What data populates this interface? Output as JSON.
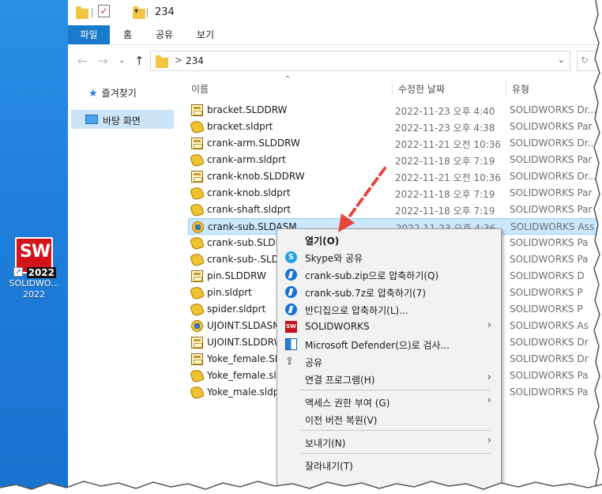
{
  "desktop": {
    "icon_label": "SOLIDWO... 2022",
    "logo_text": "SW",
    "logo_year": "2022"
  },
  "titlebar": {
    "title": "234"
  },
  "ribbon": {
    "tabs": [
      "파일",
      "홈",
      "공유",
      "보기"
    ]
  },
  "address": {
    "path": "234",
    "separator": ">"
  },
  "nav": {
    "favorites": "즐겨찾기",
    "desktop": "바탕 화면"
  },
  "columns": {
    "name": "이름",
    "date": "수정한 날짜",
    "type": "유형"
  },
  "files": [
    {
      "name": "bracket.SLDDRW",
      "date": "2022-11-23 오후 4:40",
      "type": "SOLIDWORKS Dr...",
      "kind": "drw"
    },
    {
      "name": "bracket.sldprt",
      "date": "2022-11-23 오후 4:38",
      "type": "SOLIDWORKS Par",
      "kind": "prt"
    },
    {
      "name": "crank-arm.SLDDRW",
      "date": "2022-11-21 오전 10:36",
      "type": "SOLIDWORKS Dr...",
      "kind": "drw"
    },
    {
      "name": "crank-arm.sldprt",
      "date": "2022-11-18 오후 7:19",
      "type": "SOLIDWORKS Par",
      "kind": "prt"
    },
    {
      "name": "crank-knob.SLDDRW",
      "date": "2022-11-21 오전 10:36",
      "type": "SOLIDWORKS Dr...",
      "kind": "drw"
    },
    {
      "name": "crank-knob.sldprt",
      "date": "2022-11-18 오후 7:19",
      "type": "SOLIDWORKS Par",
      "kind": "prt"
    },
    {
      "name": "crank-shaft.sldprt",
      "date": "2022-11-18 오후 7:19",
      "type": "SOLIDWORKS Par",
      "kind": "prt"
    },
    {
      "name": "crank-sub.SLDASM",
      "date": "2022-11-23 오후 4:36",
      "type": "SOLIDWORKS Ass",
      "kind": "asm",
      "selected": true
    },
    {
      "name": "crank-sub.SLDPI",
      "date": "",
      "type": "SOLIDWORKS Pa",
      "kind": "prt"
    },
    {
      "name": "crank-sub-.SLDI",
      "date": "",
      "type": "SOLIDWORKS Pa",
      "kind": "prt"
    },
    {
      "name": "pin.SLDDRW",
      "date": "",
      "type": "SOLIDWORKS D",
      "kind": "drw"
    },
    {
      "name": "pin.sldprt",
      "date": "",
      "type": "SOLIDWORKS P",
      "kind": "prt"
    },
    {
      "name": "spider.sldprt",
      "date": "",
      "type": "SOLIDWORKS P",
      "kind": "prt"
    },
    {
      "name": "UJOINT.SLDASM",
      "date": "",
      "type": "SOLIDWORKS As",
      "kind": "asm"
    },
    {
      "name": "UJOINT.SLDDRW",
      "date": "",
      "type": "SOLIDWORKS Dr",
      "kind": "drw"
    },
    {
      "name": "Yoke_female.SLD",
      "date": "",
      "type": "SOLIDWORKS Dr",
      "kind": "drw"
    },
    {
      "name": "Yoke_female.sldp",
      "date": "",
      "type": "SOLIDWORKS Pa",
      "kind": "prt"
    },
    {
      "name": "Yoke_male.sldpr",
      "date": "",
      "type": "SOLIDWORKS Pa",
      "kind": "prt"
    }
  ],
  "context_menu": {
    "open": "열기(O)",
    "skype": "Skype와 공유",
    "zip": "crank-sub.zip으로 압축하기(Q)",
    "sevenz": "crank-sub.7z로 압축하기(7)",
    "bandizip": "반디집으로 압축하기(L)...",
    "solidworks": "SOLIDWORKS",
    "defender": "Microsoft Defender(으)로 검사...",
    "share": "공유",
    "open_with": "연결 프로그램(H)",
    "access": "액세스 권한 부여 (G)",
    "restore": "이전 버전 복원(V)",
    "send_to": "보내기(N)",
    "cut": "잘라내기(T)"
  },
  "colors": {
    "accent": "#1979ca",
    "selection": "#cce8ff",
    "arrow": "#e8463c"
  }
}
